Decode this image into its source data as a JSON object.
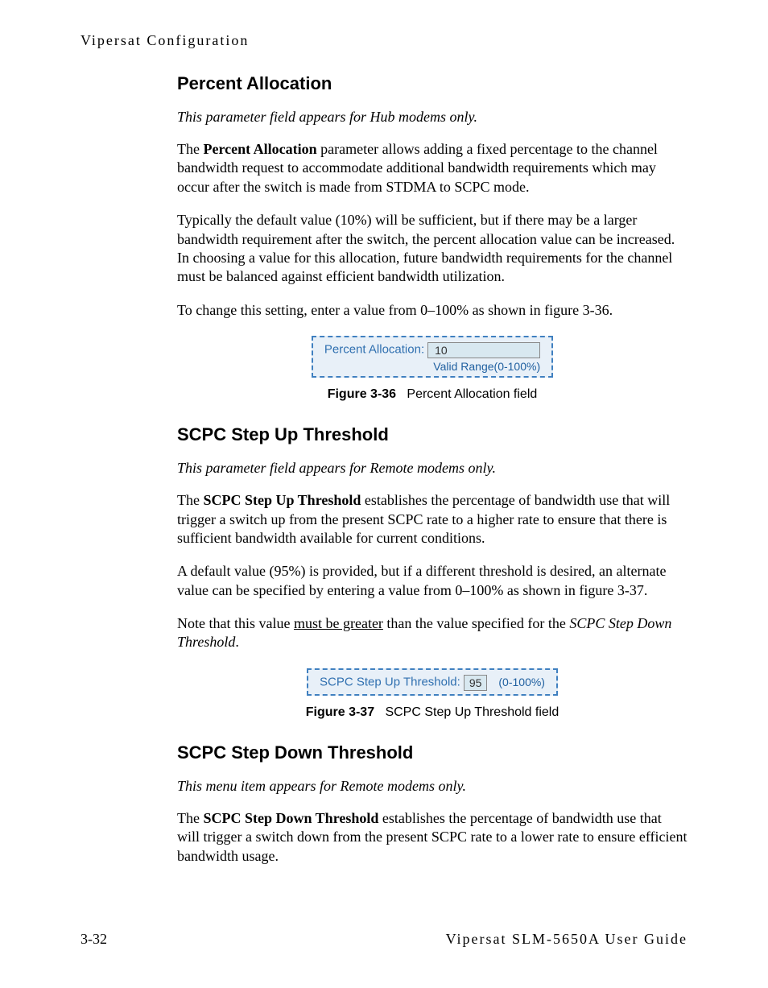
{
  "header": "Vipersat Configuration",
  "sections": {
    "percentAllocation": {
      "title": "Percent Allocation",
      "note": "This parameter field appears for Hub modems only.",
      "p1_pre": "The ",
      "p1_bold": "Percent Allocation",
      "p1_post": " parameter allows adding a fixed percentage to the channel bandwidth request to accommodate additional bandwidth requirements which may occur after the switch is made from STDMA to SCPC mode.",
      "p2": "Typically the default value (10%) will be sufficient, but if there may be a larger bandwidth requirement after the switch, the percent allocation value can be increased. In choosing a value for this allocation, future bandwidth requirements for the channel must be balanced against efficient bandwidth utilization.",
      "p3": "To change this setting, enter a value from 0–100% as shown in figure 3-36.",
      "figure": {
        "label": "Percent Allocation:",
        "value": "10",
        "hint": "Valid Range(0-100%)",
        "captionNum": "Figure 3-36",
        "captionText": "Percent Allocation field"
      }
    },
    "stepUp": {
      "title": "SCPC Step Up Threshold",
      "note": "This parameter field appears for Remote modems only.",
      "p1_pre": "The ",
      "p1_bold": "SCPC Step Up Threshold",
      "p1_post": " establishes the percentage of bandwidth use that will trigger a switch up from the present SCPC rate to a higher rate to ensure that there is sufficient bandwidth available for current conditions.",
      "p2": "A default value (95%) is provided, but if a different threshold is desired, an alternate value can be specified by entering a value from 0–100% as shown in figure 3-37.",
      "p3_pre": "Note that this value ",
      "p3_underline": "must be greater",
      "p3_mid": " than the value specified for the ",
      "p3_italic": "SCPC Step Down Threshold",
      "p3_post": ".",
      "figure": {
        "label": "SCPC Step Up Threshold:",
        "value": "95",
        "hint": "(0-100%)",
        "captionNum": "Figure 3-37",
        "captionText": "SCPC Step Up Threshold field"
      }
    },
    "stepDown": {
      "title": "SCPC Step Down Threshold",
      "note": "This menu item appears for Remote modems only.",
      "p1_pre": "The ",
      "p1_bold": "SCPC Step Down Threshold",
      "p1_post": " establishes the percentage of bandwidth use that will trigger a switch down from the present SCPC rate to a lower rate to ensure efficient bandwidth usage."
    }
  },
  "footer": {
    "left": "3-32",
    "right": "Vipersat SLM-5650A User Guide"
  }
}
